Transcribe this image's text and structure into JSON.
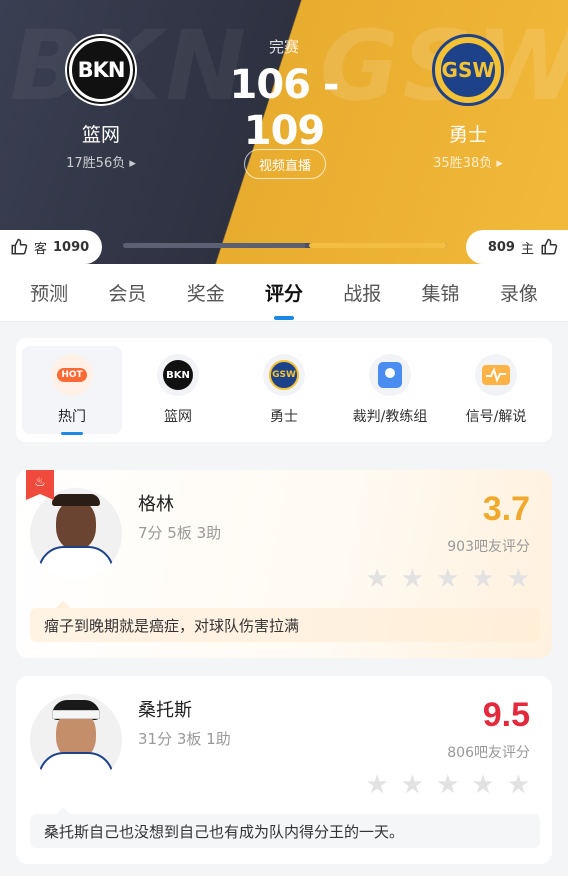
{
  "game": {
    "status": "完赛",
    "score": "106 - 109",
    "live_label": "视频直播",
    "home_team": {
      "abbr": "BKN",
      "name": "篮网",
      "record": "17胜56负 ▸"
    },
    "away_team": {
      "abbr": "GSW",
      "name": "勇士",
      "record": "35胜38负 ▸"
    },
    "watermark_left": "BKN",
    "watermark_right": "GSW"
  },
  "votes": {
    "left_prefix": "客",
    "left_count": "1090",
    "right_count": "809",
    "right_suffix": "主",
    "left_share": 0.574,
    "right_share": 0.426
  },
  "tabs": [
    "预测",
    "会员",
    "奖金",
    "评分",
    "战报",
    "集锦",
    "录像"
  ],
  "active_tab": "评分",
  "filters": [
    {
      "label": "热门",
      "icon": "hot-icon",
      "badge": "HOT"
    },
    {
      "label": "篮网",
      "icon": "bkn-logo-icon",
      "badge": "BKN"
    },
    {
      "label": "勇士",
      "icon": "gsw-logo-icon",
      "badge": "GSW"
    },
    {
      "label": "裁判/教练组",
      "icon": "referee-icon",
      "badge": ""
    },
    {
      "label": "信号/解说",
      "icon": "signal-icon",
      "badge": ""
    }
  ],
  "players": [
    {
      "name": "格林",
      "stats": "7分 5板 3助",
      "rating": "3.7",
      "rating_color": "#f0a92a",
      "count": "903吧友评分",
      "comment": "瘤子到晚期就是癌症，对球队伤害拉满",
      "hot": true
    },
    {
      "name": "桑托斯",
      "stats": "31分 3板 1助",
      "rating": "9.5",
      "rating_color": "#e5293c",
      "count": "806吧友评分",
      "comment": "桑托斯自己也没想到自己也有成为队内得分王的一天。",
      "hot": false
    }
  ]
}
